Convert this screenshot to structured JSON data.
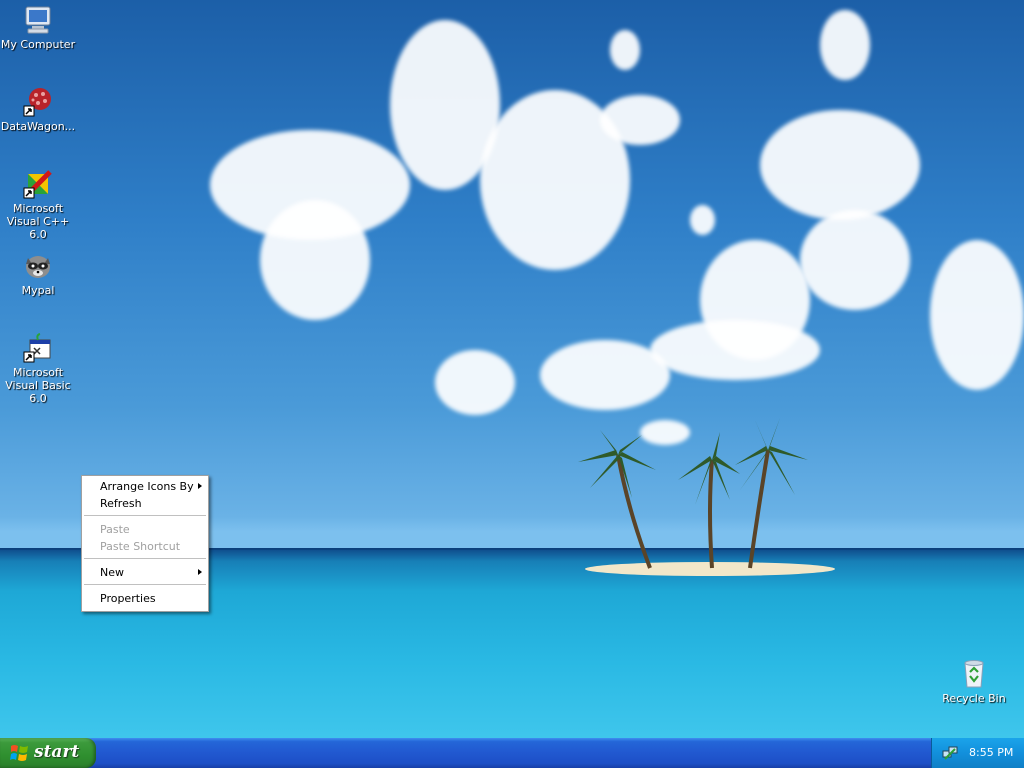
{
  "desktop": {
    "icons": [
      {
        "label": "My Computer",
        "icon": "computer-icon"
      },
      {
        "label": "DataWagon...",
        "icon": "datawagon-icon"
      },
      {
        "label": "Microsoft Visual C++ 6.0",
        "icon": "visual-cpp-icon"
      },
      {
        "label": "Mypal",
        "icon": "mypal-raccoon-icon"
      },
      {
        "label": "Microsoft Visual Basic 6.0",
        "icon": "visual-basic-icon"
      },
      {
        "label": "Recycle Bin",
        "icon": "recycle-bin-icon"
      }
    ]
  },
  "context_menu": {
    "items": [
      {
        "label": "Arrange Icons By",
        "submenu": true,
        "enabled": true
      },
      {
        "label": "Refresh",
        "submenu": false,
        "enabled": true
      },
      {
        "label": "Paste",
        "submenu": false,
        "enabled": false
      },
      {
        "label": "Paste Shortcut",
        "submenu": false,
        "enabled": false
      },
      {
        "label": "New",
        "submenu": true,
        "enabled": true
      },
      {
        "label": "Properties",
        "submenu": false,
        "enabled": true
      }
    ]
  },
  "taskbar": {
    "start_label": "start",
    "clock": "8:55 PM",
    "tray_icon": "network-icon"
  },
  "colors": {
    "taskbar_blue": "#2158d0",
    "start_green": "#3c9a3c",
    "tray_blue": "#1290dc"
  }
}
